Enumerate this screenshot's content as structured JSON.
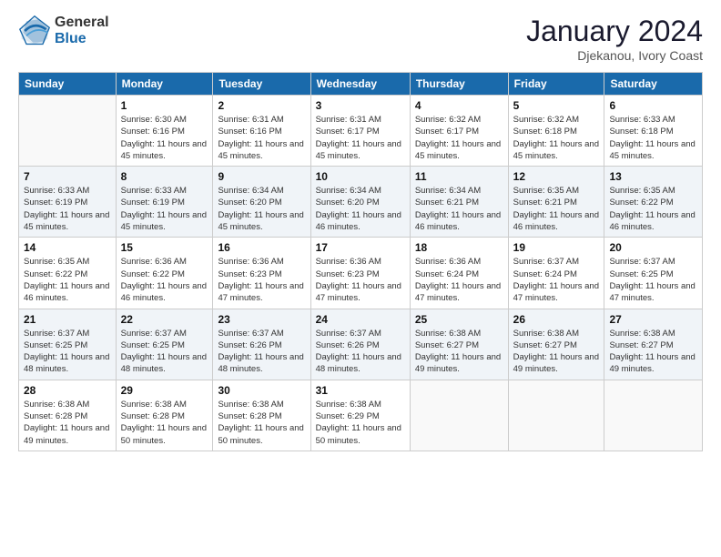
{
  "logo": {
    "general": "General",
    "blue": "Blue"
  },
  "title": "January 2024",
  "subtitle": "Djekanou, Ivory Coast",
  "days_header": [
    "Sunday",
    "Monday",
    "Tuesday",
    "Wednesday",
    "Thursday",
    "Friday",
    "Saturday"
  ],
  "weeks": [
    [
      {
        "num": "",
        "sunrise": "",
        "sunset": "",
        "daylight": ""
      },
      {
        "num": "1",
        "sunrise": "Sunrise: 6:30 AM",
        "sunset": "Sunset: 6:16 PM",
        "daylight": "Daylight: 11 hours and 45 minutes."
      },
      {
        "num": "2",
        "sunrise": "Sunrise: 6:31 AM",
        "sunset": "Sunset: 6:16 PM",
        "daylight": "Daylight: 11 hours and 45 minutes."
      },
      {
        "num": "3",
        "sunrise": "Sunrise: 6:31 AM",
        "sunset": "Sunset: 6:17 PM",
        "daylight": "Daylight: 11 hours and 45 minutes."
      },
      {
        "num": "4",
        "sunrise": "Sunrise: 6:32 AM",
        "sunset": "Sunset: 6:17 PM",
        "daylight": "Daylight: 11 hours and 45 minutes."
      },
      {
        "num": "5",
        "sunrise": "Sunrise: 6:32 AM",
        "sunset": "Sunset: 6:18 PM",
        "daylight": "Daylight: 11 hours and 45 minutes."
      },
      {
        "num": "6",
        "sunrise": "Sunrise: 6:33 AM",
        "sunset": "Sunset: 6:18 PM",
        "daylight": "Daylight: 11 hours and 45 minutes."
      }
    ],
    [
      {
        "num": "7",
        "sunrise": "Sunrise: 6:33 AM",
        "sunset": "Sunset: 6:19 PM",
        "daylight": "Daylight: 11 hours and 45 minutes."
      },
      {
        "num": "8",
        "sunrise": "Sunrise: 6:33 AM",
        "sunset": "Sunset: 6:19 PM",
        "daylight": "Daylight: 11 hours and 45 minutes."
      },
      {
        "num": "9",
        "sunrise": "Sunrise: 6:34 AM",
        "sunset": "Sunset: 6:20 PM",
        "daylight": "Daylight: 11 hours and 45 minutes."
      },
      {
        "num": "10",
        "sunrise": "Sunrise: 6:34 AM",
        "sunset": "Sunset: 6:20 PM",
        "daylight": "Daylight: 11 hours and 46 minutes."
      },
      {
        "num": "11",
        "sunrise": "Sunrise: 6:34 AM",
        "sunset": "Sunset: 6:21 PM",
        "daylight": "Daylight: 11 hours and 46 minutes."
      },
      {
        "num": "12",
        "sunrise": "Sunrise: 6:35 AM",
        "sunset": "Sunset: 6:21 PM",
        "daylight": "Daylight: 11 hours and 46 minutes."
      },
      {
        "num": "13",
        "sunrise": "Sunrise: 6:35 AM",
        "sunset": "Sunset: 6:22 PM",
        "daylight": "Daylight: 11 hours and 46 minutes."
      }
    ],
    [
      {
        "num": "14",
        "sunrise": "Sunrise: 6:35 AM",
        "sunset": "Sunset: 6:22 PM",
        "daylight": "Daylight: 11 hours and 46 minutes."
      },
      {
        "num": "15",
        "sunrise": "Sunrise: 6:36 AM",
        "sunset": "Sunset: 6:22 PM",
        "daylight": "Daylight: 11 hours and 46 minutes."
      },
      {
        "num": "16",
        "sunrise": "Sunrise: 6:36 AM",
        "sunset": "Sunset: 6:23 PM",
        "daylight": "Daylight: 11 hours and 47 minutes."
      },
      {
        "num": "17",
        "sunrise": "Sunrise: 6:36 AM",
        "sunset": "Sunset: 6:23 PM",
        "daylight": "Daylight: 11 hours and 47 minutes."
      },
      {
        "num": "18",
        "sunrise": "Sunrise: 6:36 AM",
        "sunset": "Sunset: 6:24 PM",
        "daylight": "Daylight: 11 hours and 47 minutes."
      },
      {
        "num": "19",
        "sunrise": "Sunrise: 6:37 AM",
        "sunset": "Sunset: 6:24 PM",
        "daylight": "Daylight: 11 hours and 47 minutes."
      },
      {
        "num": "20",
        "sunrise": "Sunrise: 6:37 AM",
        "sunset": "Sunset: 6:25 PM",
        "daylight": "Daylight: 11 hours and 47 minutes."
      }
    ],
    [
      {
        "num": "21",
        "sunrise": "Sunrise: 6:37 AM",
        "sunset": "Sunset: 6:25 PM",
        "daylight": "Daylight: 11 hours and 48 minutes."
      },
      {
        "num": "22",
        "sunrise": "Sunrise: 6:37 AM",
        "sunset": "Sunset: 6:25 PM",
        "daylight": "Daylight: 11 hours and 48 minutes."
      },
      {
        "num": "23",
        "sunrise": "Sunrise: 6:37 AM",
        "sunset": "Sunset: 6:26 PM",
        "daylight": "Daylight: 11 hours and 48 minutes."
      },
      {
        "num": "24",
        "sunrise": "Sunrise: 6:37 AM",
        "sunset": "Sunset: 6:26 PM",
        "daylight": "Daylight: 11 hours and 48 minutes."
      },
      {
        "num": "25",
        "sunrise": "Sunrise: 6:38 AM",
        "sunset": "Sunset: 6:27 PM",
        "daylight": "Daylight: 11 hours and 49 minutes."
      },
      {
        "num": "26",
        "sunrise": "Sunrise: 6:38 AM",
        "sunset": "Sunset: 6:27 PM",
        "daylight": "Daylight: 11 hours and 49 minutes."
      },
      {
        "num": "27",
        "sunrise": "Sunrise: 6:38 AM",
        "sunset": "Sunset: 6:27 PM",
        "daylight": "Daylight: 11 hours and 49 minutes."
      }
    ],
    [
      {
        "num": "28",
        "sunrise": "Sunrise: 6:38 AM",
        "sunset": "Sunset: 6:28 PM",
        "daylight": "Daylight: 11 hours and 49 minutes."
      },
      {
        "num": "29",
        "sunrise": "Sunrise: 6:38 AM",
        "sunset": "Sunset: 6:28 PM",
        "daylight": "Daylight: 11 hours and 50 minutes."
      },
      {
        "num": "30",
        "sunrise": "Sunrise: 6:38 AM",
        "sunset": "Sunset: 6:28 PM",
        "daylight": "Daylight: 11 hours and 50 minutes."
      },
      {
        "num": "31",
        "sunrise": "Sunrise: 6:38 AM",
        "sunset": "Sunset: 6:29 PM",
        "daylight": "Daylight: 11 hours and 50 minutes."
      },
      {
        "num": "",
        "sunrise": "",
        "sunset": "",
        "daylight": ""
      },
      {
        "num": "",
        "sunrise": "",
        "sunset": "",
        "daylight": ""
      },
      {
        "num": "",
        "sunrise": "",
        "sunset": "",
        "daylight": ""
      }
    ]
  ]
}
